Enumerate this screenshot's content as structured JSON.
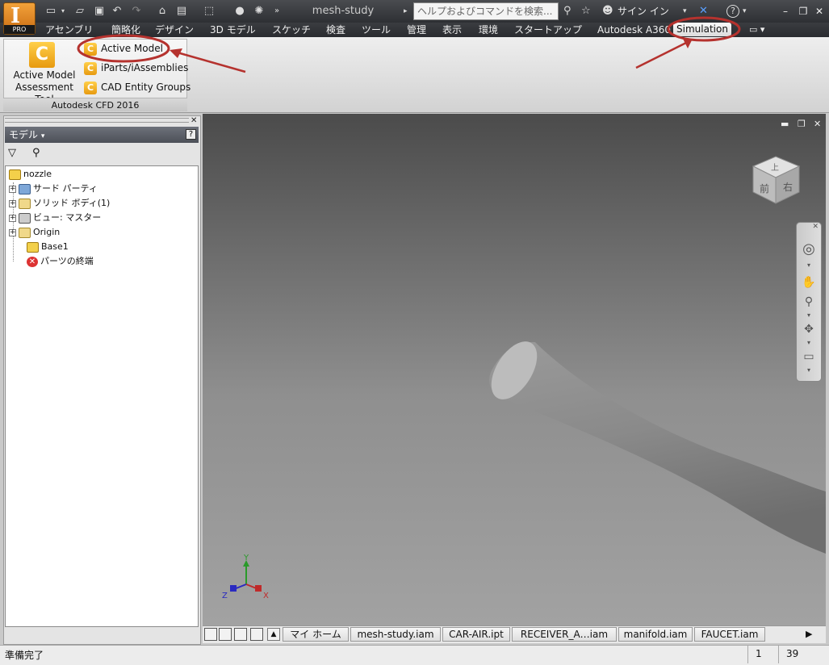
{
  "window": {
    "document_title": "mesh-study",
    "app_badge": "PRO"
  },
  "search": {
    "placeholder": "ヘルプおよびコマンドを検索..."
  },
  "user": {
    "sign_in": "サイン イン"
  },
  "ribbon_tabs": [
    "アセンブリ",
    "簡略化",
    "デザイン",
    "3D モデル",
    "スケッチ",
    "検査",
    "ツール",
    "管理",
    "表示",
    "環境",
    "スタートアップ",
    "Autodesk A360",
    "Simulation"
  ],
  "ribbon": {
    "panel_title": "Autodesk CFD 2016",
    "big_button_label_1": "Active Model",
    "big_button_label_2": "Assessment Tool",
    "small_buttons": [
      "Active Model",
      "iParts/iAssemblies",
      "CAD Entity Groups"
    ]
  },
  "browser": {
    "title": "モデル",
    "tree": [
      {
        "label": "nozzle",
        "level": 0,
        "expander": false,
        "icon": "part-icon"
      },
      {
        "label": "サード パーティ",
        "level": 1,
        "expander": true,
        "icon": "third-party-icon"
      },
      {
        "label": "ソリッド ボディ(1)",
        "level": 1,
        "expander": true,
        "icon": "folder-icon"
      },
      {
        "label": "ビュー: マスター",
        "level": 1,
        "expander": true,
        "icon": "view-icon"
      },
      {
        "label": "Origin",
        "level": 1,
        "expander": true,
        "icon": "folder-icon"
      },
      {
        "label": "Base1",
        "level": 1,
        "expander": false,
        "icon": "part-icon"
      },
      {
        "label": "パーツの終端",
        "level": 1,
        "expander": false,
        "icon": "end-of-part-icon"
      }
    ]
  },
  "viewcube": {
    "top": "上",
    "front": "前",
    "right": "右"
  },
  "triad": {
    "x": "X",
    "y": "Y",
    "z": "Z"
  },
  "doc_tabs": [
    "マイ ホーム",
    "mesh-study.iam",
    "CAR-AIR.ipt",
    "RECEIVER_A…iam",
    "manifold.iam",
    "FAUCET.iam"
  ],
  "status": {
    "text": "準備完了",
    "value_1": "1",
    "value_2": "39"
  },
  "colors": {
    "accent": "#e79a10",
    "highlight_ring": "#b5322e"
  }
}
